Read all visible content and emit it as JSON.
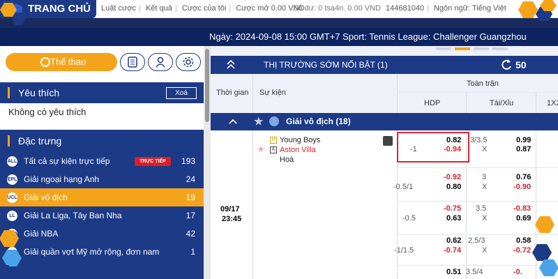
{
  "topbar": {
    "home_label": "TRANG CHỦ",
    "links": [
      "Luật cược",
      "Kết quả",
      "Cược của tôi"
    ],
    "stake_text": "Cược mở 0.00 VND",
    "overlap_text": "Số dư: 0 tsa4n. 0.00 VND",
    "account_id": "144681040",
    "language": "Ngôn ngữ: Tiếng Việt"
  },
  "ticker": {
    "text": "Ngày:  2024-09-08 15:00 GMT+7 Sport: Tennis League: Challenger Guangzhou"
  },
  "left": {
    "sports_tab": "Thể thao",
    "favorites_title": "Yêu thích",
    "clear_label": "Xoá",
    "no_favorites": "Không có yêu thích",
    "featured_title": "Đặc trưng",
    "live_badge": "TRỰC TIẾP",
    "items": [
      {
        "icon": "ALL",
        "label": "Tất cả sự kiện trực tiếp",
        "count": "193"
      },
      {
        "icon": "EPL",
        "label": "Giải ngoại hạng Anh",
        "count": "24"
      },
      {
        "icon": "UCL",
        "label": "Giải vô địch",
        "count": "19"
      },
      {
        "icon": "LL",
        "label": "Giải La Liga, Tây Ban Nha",
        "count": "17"
      },
      {
        "icon": "NBA",
        "label": "Giải NBA",
        "count": "42"
      },
      {
        "icon": "US",
        "label": "Giải quần vợt Mỹ mở rộng, đơn nam",
        "count": "1"
      }
    ]
  },
  "market": {
    "title": "THỊ TRƯỜNG SỚM NỔI BẬT (1)",
    "refresh_count": "50",
    "col_time": "Thời gian",
    "col_event": "Sự kiện",
    "col_fulltime": "Toàn trận",
    "col_hdp": "HDP",
    "col_ou": "Tài/Xỉu",
    "col_1x2": "1X2",
    "league": "Giải vô địch (18)"
  },
  "match": {
    "date": "09/17",
    "time": "23:45",
    "home": "Young Boys",
    "away": "Aston Villa",
    "draw": "Hoà",
    "home_tag": "H",
    "away_tag": "A"
  },
  "odds": [
    {
      "hdp": "-1",
      "hdp_home": "0.82",
      "hdp_away": "-0.94",
      "ou_line": "3/3.5",
      "ou_x": "X",
      "ou_over": "0.99",
      "ou_under": "0.87"
    },
    {
      "hdp": "-0.5/1",
      "hdp_home": "-0.92",
      "hdp_away": "0.80",
      "ou_line": "3",
      "ou_x": "X",
      "ou_over": "0.76",
      "ou_under": "-0.90"
    },
    {
      "hdp": "-0.5",
      "hdp_home": "-0.75",
      "hdp_away": "0.63",
      "ou_line": "3.5",
      "ou_x": "X",
      "ou_over": "-0.83",
      "ou_under": "0.69"
    },
    {
      "hdp": "-1/1.5",
      "hdp_home": "0.62",
      "hdp_away": "-0.74",
      "ou_line": "2.5/3",
      "ou_x": "X",
      "ou_over": "0.58",
      "ou_under": "-0.72"
    },
    {
      "hdp": "",
      "hdp_home": "0.51",
      "hdp_away": "",
      "ou_line": "3.5/4",
      "ou_x": "",
      "ou_over": "-0.",
      "ou_under": ""
    }
  ],
  "colors": {
    "navy": "#1c3a86",
    "orange": "#f4a41b",
    "red": "#d81f2c"
  }
}
